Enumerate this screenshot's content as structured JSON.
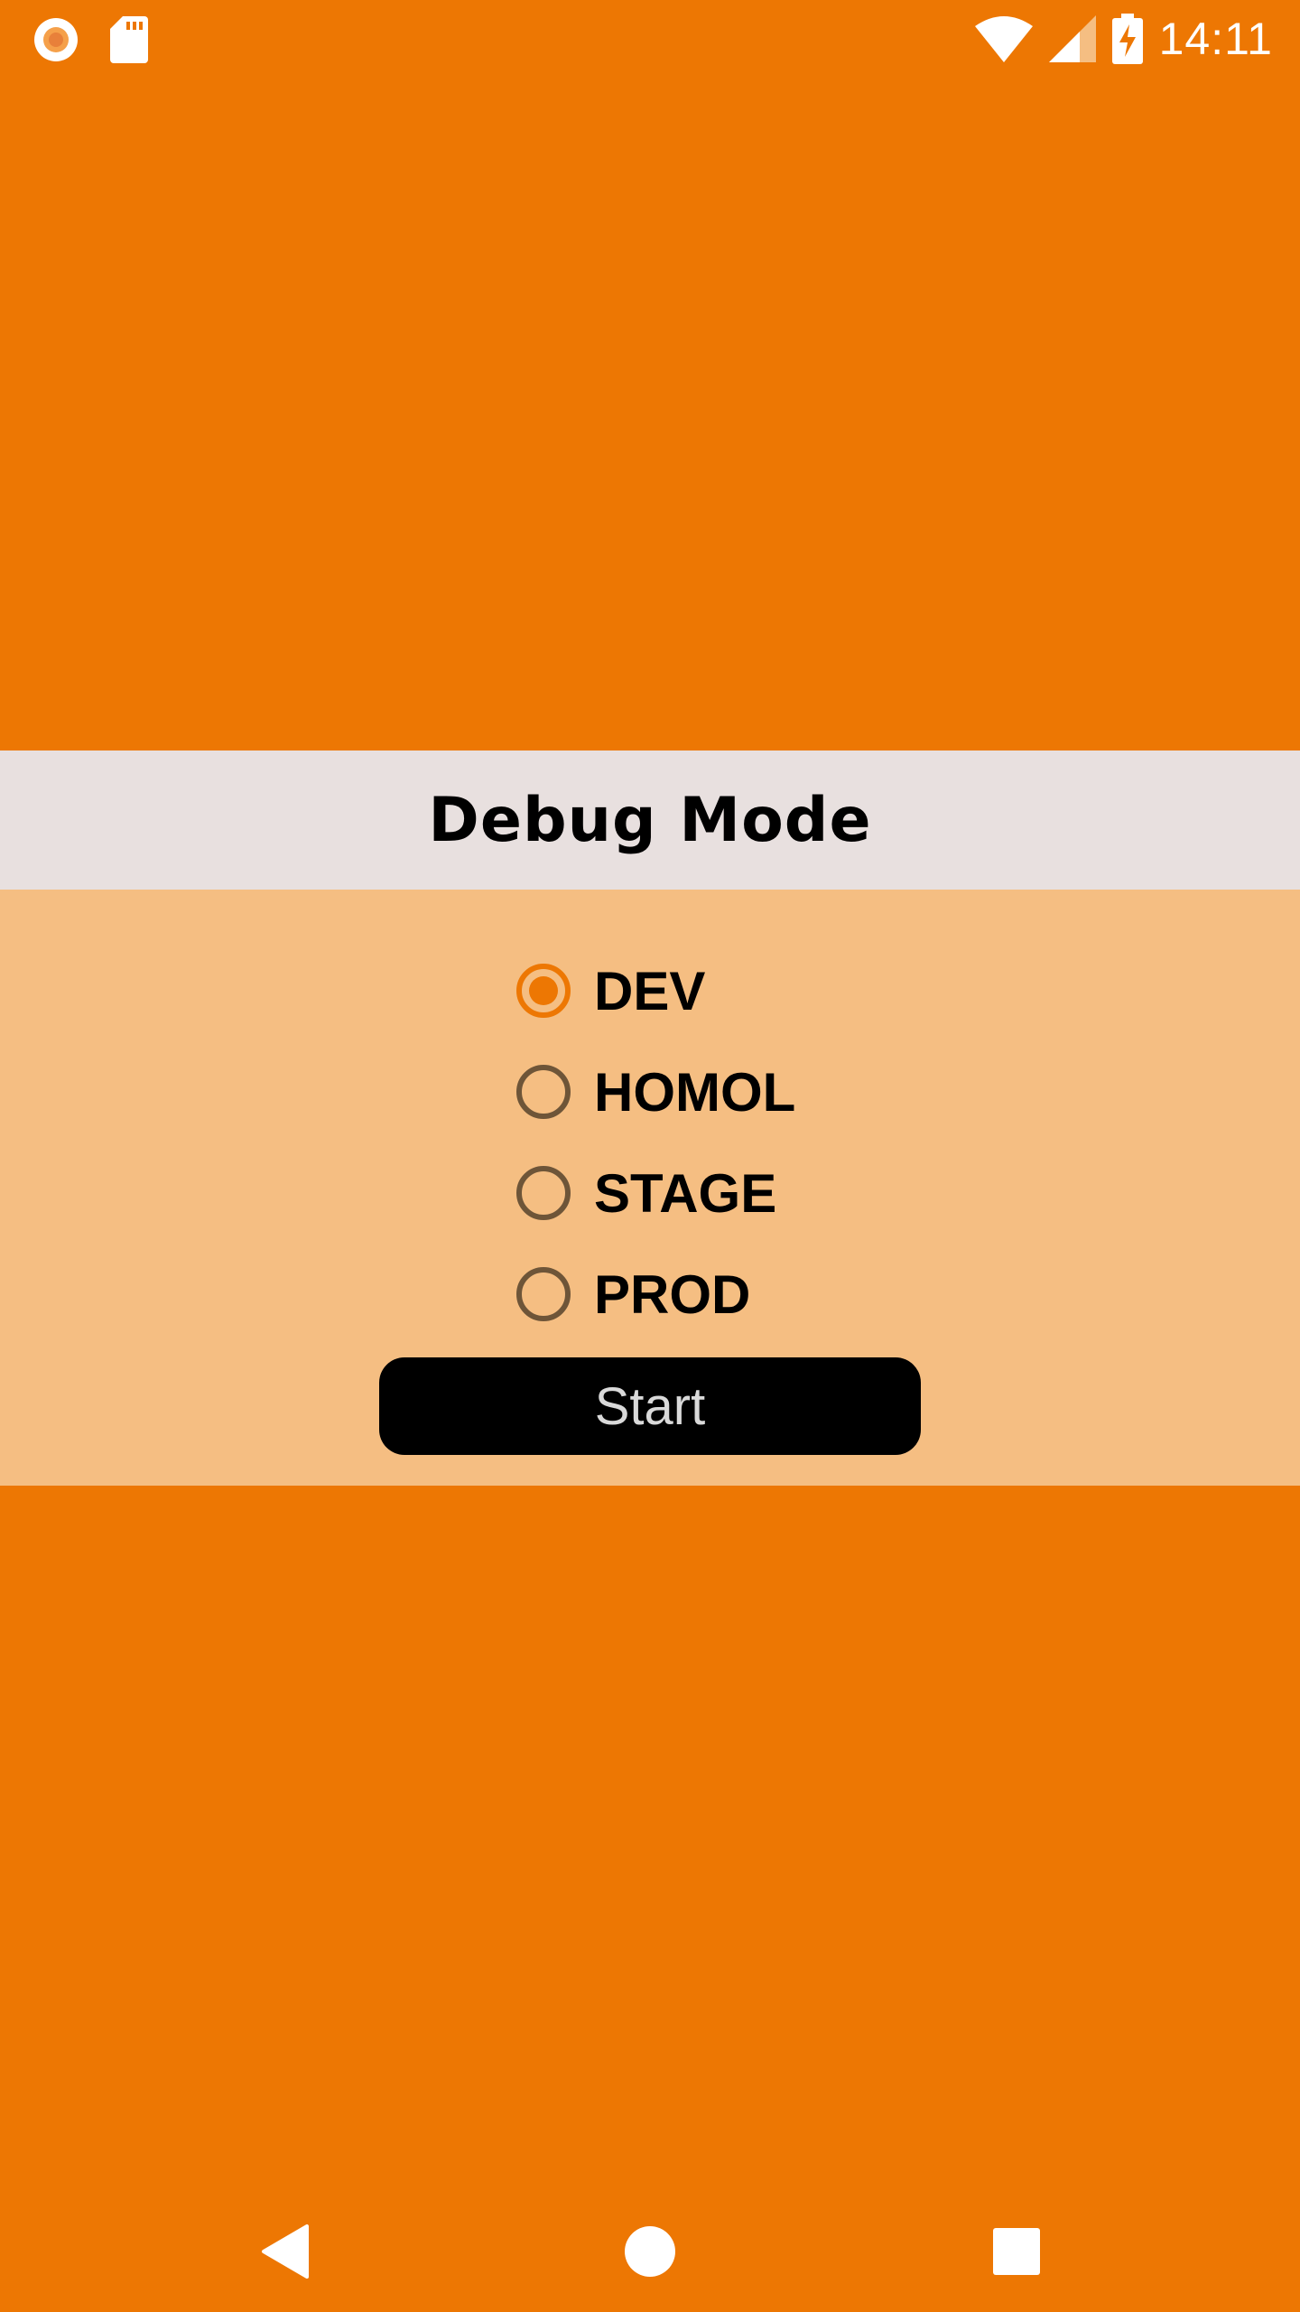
{
  "status_bar": {
    "time": "14:11",
    "left_icons": [
      "record-icon",
      "sd-card-icon"
    ],
    "right_icons": [
      "wifi-icon",
      "signal-icon",
      "battery-charging-icon"
    ]
  },
  "dialog": {
    "title": "Debug Mode",
    "options": [
      {
        "label": "DEV",
        "checked": true
      },
      {
        "label": "HOMOL",
        "checked": false
      },
      {
        "label": "STAGE",
        "checked": false
      },
      {
        "label": "PROD",
        "checked": false
      }
    ],
    "start_label": "Start"
  },
  "nav_bar": {
    "icons": [
      "back-icon",
      "home-icon",
      "recents-icon"
    ]
  },
  "colors": {
    "background": "#ED7703",
    "title_bar": "#E8E0DF",
    "dialog_body": "#F5BE82",
    "button": "#000000",
    "accent": "#ED7703"
  }
}
